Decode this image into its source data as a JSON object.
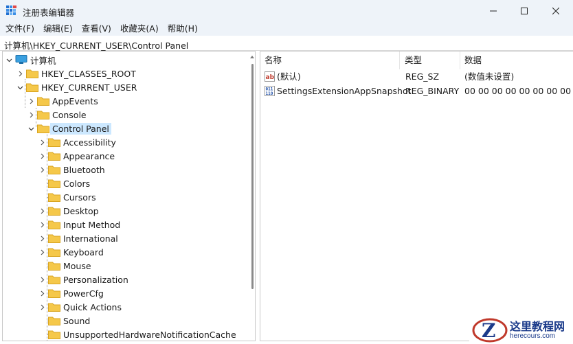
{
  "window": {
    "title": "注册表编辑器"
  },
  "menu": [
    "文件(F)",
    "编辑(E)",
    "查看(V)",
    "收藏夹(A)",
    "帮助(H)"
  ],
  "address": "计算机\\HKEY_CURRENT_USER\\Control Panel",
  "tree": {
    "root": "计算机",
    "hives": [
      "HKEY_CLASSES_ROOT",
      "HKEY_CURRENT_USER"
    ],
    "hkcu_children": [
      "AppEvents",
      "Console",
      "Control Panel"
    ],
    "control_panel_children": [
      "Accessibility",
      "Appearance",
      "Bluetooth",
      "Colors",
      "Cursors",
      "Desktop",
      "Input Method",
      "International",
      "Keyboard",
      "Mouse",
      "Personalization",
      "PowerCfg",
      "Quick Actions",
      "Sound",
      "UnsupportedHardwareNotificationCache"
    ]
  },
  "list": {
    "columns": [
      "名称",
      "类型",
      "数据"
    ],
    "rows": [
      {
        "icon": "string-value-icon",
        "name": "(默认)",
        "type": "REG_SZ",
        "data": "(数值未设置)"
      },
      {
        "icon": "binary-value-icon",
        "name": "SettingsExtensionAppSnapshot",
        "type": "REG_BINARY",
        "data": "00 00 00 00 00 00 00 00"
      }
    ]
  },
  "watermark": {
    "title": "这里教程网",
    "url": "herecours.com"
  }
}
